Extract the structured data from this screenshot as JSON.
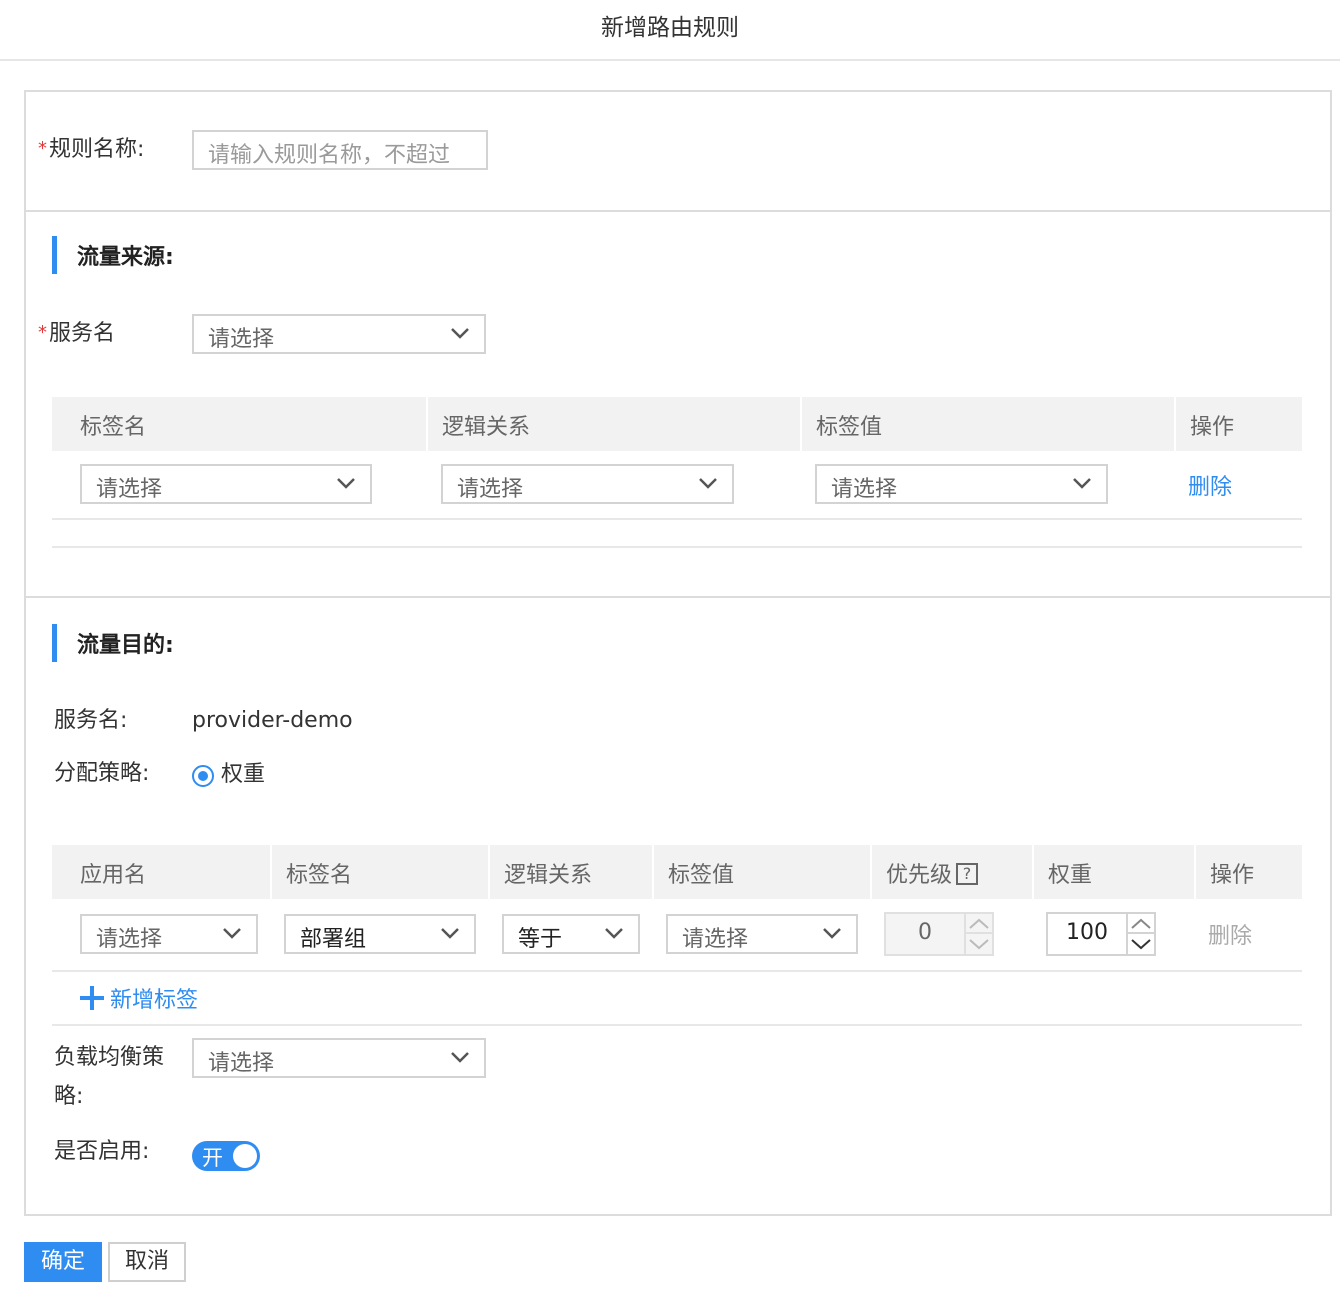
{
  "dialog": {
    "title": "新增路由规则"
  },
  "rule_name": {
    "label": "规则名称:",
    "required_mark": "*",
    "placeholder": "请输入规则名称，不超过"
  },
  "source": {
    "heading": "流量来源:",
    "service_label": "服务名",
    "service_required_mark": "*",
    "service_select": "请选择",
    "table": {
      "headers": [
        "标签名",
        "逻辑关系",
        "标签值",
        "操作"
      ],
      "rows": [
        {
          "tag_name": "请选择",
          "logic": "请选择",
          "tag_value": "请选择",
          "action": "删除"
        }
      ]
    }
  },
  "destination": {
    "heading": "流量目的:",
    "service_label": "服务名:",
    "service_value": "provider-demo",
    "strategy_label": "分配策略:",
    "strategy_option": "权重",
    "table": {
      "headers": [
        "应用名",
        "标签名",
        "逻辑关系",
        "标签值",
        "优先级",
        "权重",
        "操作"
      ],
      "help_icon": "?",
      "rows": [
        {
          "app": "请选择",
          "tag_name": "部署组",
          "logic": "等于",
          "tag_value": "请选择",
          "priority": "0",
          "weight": "100",
          "action": "删除"
        }
      ]
    },
    "add_tag": "新增标签",
    "lb_label_line1": "负载均衡策",
    "lb_label_line2": "略:",
    "lb_select": "请选择",
    "enable_label": "是否启用:",
    "toggle_text": "开",
    "toggle_on": true
  },
  "footer": {
    "confirm": "确定",
    "cancel": "取消"
  },
  "colors": {
    "accent": "#2f8cf0",
    "required": "#e23a3a",
    "header_bg": "#f2f2f2"
  }
}
